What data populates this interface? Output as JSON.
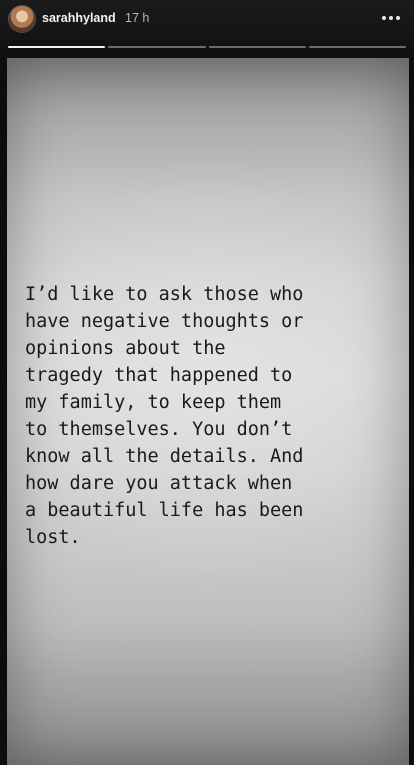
{
  "header": {
    "username": "sarahhyland",
    "timestamp": "17 h",
    "more_icon": "more-horizontal-icon"
  },
  "progress": {
    "segments_total": 4,
    "segments_done": 1
  },
  "story": {
    "text": "I’d like to ask those who\nhave negative thoughts or\nopinions about the\ntragedy that happened to\nmy family, to keep them\nto themselves. You don’t\nknow all the details. And\nhow dare you attack when\na beautiful life has been\nlost."
  }
}
